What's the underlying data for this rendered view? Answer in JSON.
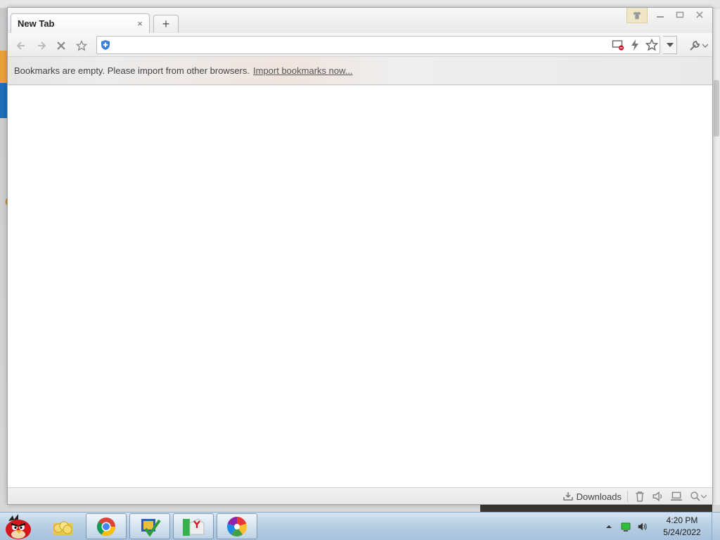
{
  "browser": {
    "tab": {
      "title": "New Tab",
      "close_glyph": "×"
    },
    "new_tab_glyph": "+",
    "toolbar": {
      "back_icon": "back-arrow-icon",
      "forward_icon": "forward-arrow-icon",
      "stop_icon": "stop-x-icon",
      "favorite_icon": "star-icon",
      "address_value": "",
      "address_placeholder": ""
    },
    "bookmarks_bar": {
      "message": "Bookmarks are empty. Please import from other browsers.",
      "import_link": "Import bookmarks now..."
    },
    "statusbar": {
      "downloads_label": "Downloads"
    }
  },
  "taskbar": {
    "clock_time": "4:20 PM",
    "clock_date": "5/24/2022",
    "pinned": [
      "angry-birds-icon",
      "file-explorer-icon",
      "chrome-icon",
      "checklist-app-icon",
      "installer-app-icon",
      "media-player-icon"
    ]
  },
  "colors": {
    "accent_blue": "#1d6fb8",
    "taskbar_bg": "#b8cfe4",
    "link": "#555555"
  }
}
